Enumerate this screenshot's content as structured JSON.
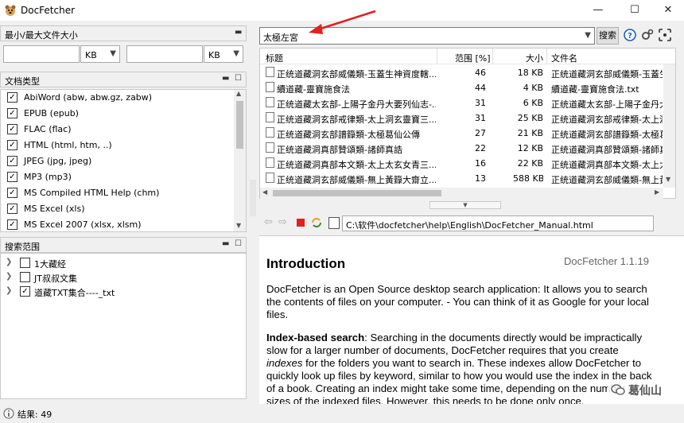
{
  "app": {
    "title": "DocFetcher",
    "controls": {
      "minimize": "—",
      "maximize": "☐",
      "close": "✕"
    }
  },
  "size_filter": {
    "header": "最小/最大文件大小",
    "min_value": "",
    "min_unit": "KB",
    "max_value": "",
    "max_unit": "KB"
  },
  "file_types": {
    "header": "文档类型",
    "items": [
      {
        "label": "AbiWord (abw, abw.gz, zabw)",
        "checked": "✓"
      },
      {
        "label": "EPUB (epub)",
        "checked": "✓"
      },
      {
        "label": "FLAC (flac)",
        "checked": "✓"
      },
      {
        "label": "HTML (html, htm, ..)",
        "checked": "✓"
      },
      {
        "label": "JPEG (jpg, jpeg)",
        "checked": "✓"
      },
      {
        "label": "MP3 (mp3)",
        "checked": "✓"
      },
      {
        "label": "MS Compiled HTML Help (chm)",
        "checked": "✓"
      },
      {
        "label": "MS Excel (xls)",
        "checked": "✓"
      },
      {
        "label": "MS Excel 2007 (xlsx, xlsm)",
        "checked": "✓"
      }
    ]
  },
  "scope": {
    "header": "搜索范围",
    "items": [
      {
        "label": "1大藏经",
        "checked": ""
      },
      {
        "label": "JT叔叔文集",
        "checked": ""
      },
      {
        "label": "道藏TXT集合----_txt",
        "checked": "✓"
      }
    ]
  },
  "search": {
    "query": "太極左宮",
    "button": "搜索"
  },
  "results": {
    "columns": {
      "title": "标题",
      "score": "范围 [%]",
      "size": "大小",
      "filename": "文件名"
    },
    "rows": [
      {
        "title": "正统道藏洞玄部威儀類-玉蓋生神資度轄...",
        "score": "46",
        "size": "18 KB",
        "filename": "正统道藏洞玄部威儀類-玉蓋生"
      },
      {
        "title": "續道藏-靈寶施食法",
        "score": "44",
        "size": "4 KB",
        "filename": "續道藏-靈寶施食法.txt"
      },
      {
        "title": "正统道藏太玄部-上陽子金丹大要列仙志-...",
        "score": "31",
        "size": "6 KB",
        "filename": "正统道藏太玄部-上陽子金丹大"
      },
      {
        "title": "正统道藏洞玄部戒律類-太上洞玄靈寶三...",
        "score": "31",
        "size": "25 KB",
        "filename": "正统道藏洞玄部戒律類-太上洞"
      },
      {
        "title": "正统道藏洞玄部譜籙類-太極葛仙公傳",
        "score": "27",
        "size": "21 KB",
        "filename": "正统道藏洞玄部譜籙類-太極葛"
      },
      {
        "title": "正统道藏洞真部贊頌類-諸師真誥",
        "score": "22",
        "size": "12 KB",
        "filename": "正统道藏洞真部贊頌類-諸師真"
      },
      {
        "title": "正统道藏洞真部本文類-太上太玄女青三...",
        "score": "16",
        "size": "22 KB",
        "filename": "正统道藏洞真部本文類-太上太"
      },
      {
        "title": "正统道藏洞玄部威儀類-無上黃籙大齋立...",
        "score": "13",
        "size": "588 KB",
        "filename": "正统道藏洞玄部威儀類-無上黃"
      }
    ]
  },
  "browser": {
    "url": "C:\\软件\\docfetcher\\help\\English\\DocFetcher_Manual.html"
  },
  "document": {
    "heading": "Introduction",
    "version": "DocFetcher 1.1.19",
    "p1": "DocFetcher is an Open Source desktop search application: It allows you to search the contents of files on your computer. - You can think of it as Google for your local files.",
    "p2_bold": "Index-based search",
    "p2_a": ": Searching in the documents directly would be impractically slow for a larger number of documents, DocFetcher requires that you create ",
    "p2_em": "indexes",
    "p2_b": " for the folders you want to search in. These indexes allow DocFetcher to quickly look up files by keyword, similar to how you would use the index in the back of a book. Creating an index might take some time, depending on the number and sizes of the indexed files. However, this needs to be done only once."
  },
  "watermark": "葛仙山",
  "status": {
    "text": "结果: 49"
  },
  "colors": {
    "accent_red": "#e22020",
    "highlight": "#0078d7"
  }
}
